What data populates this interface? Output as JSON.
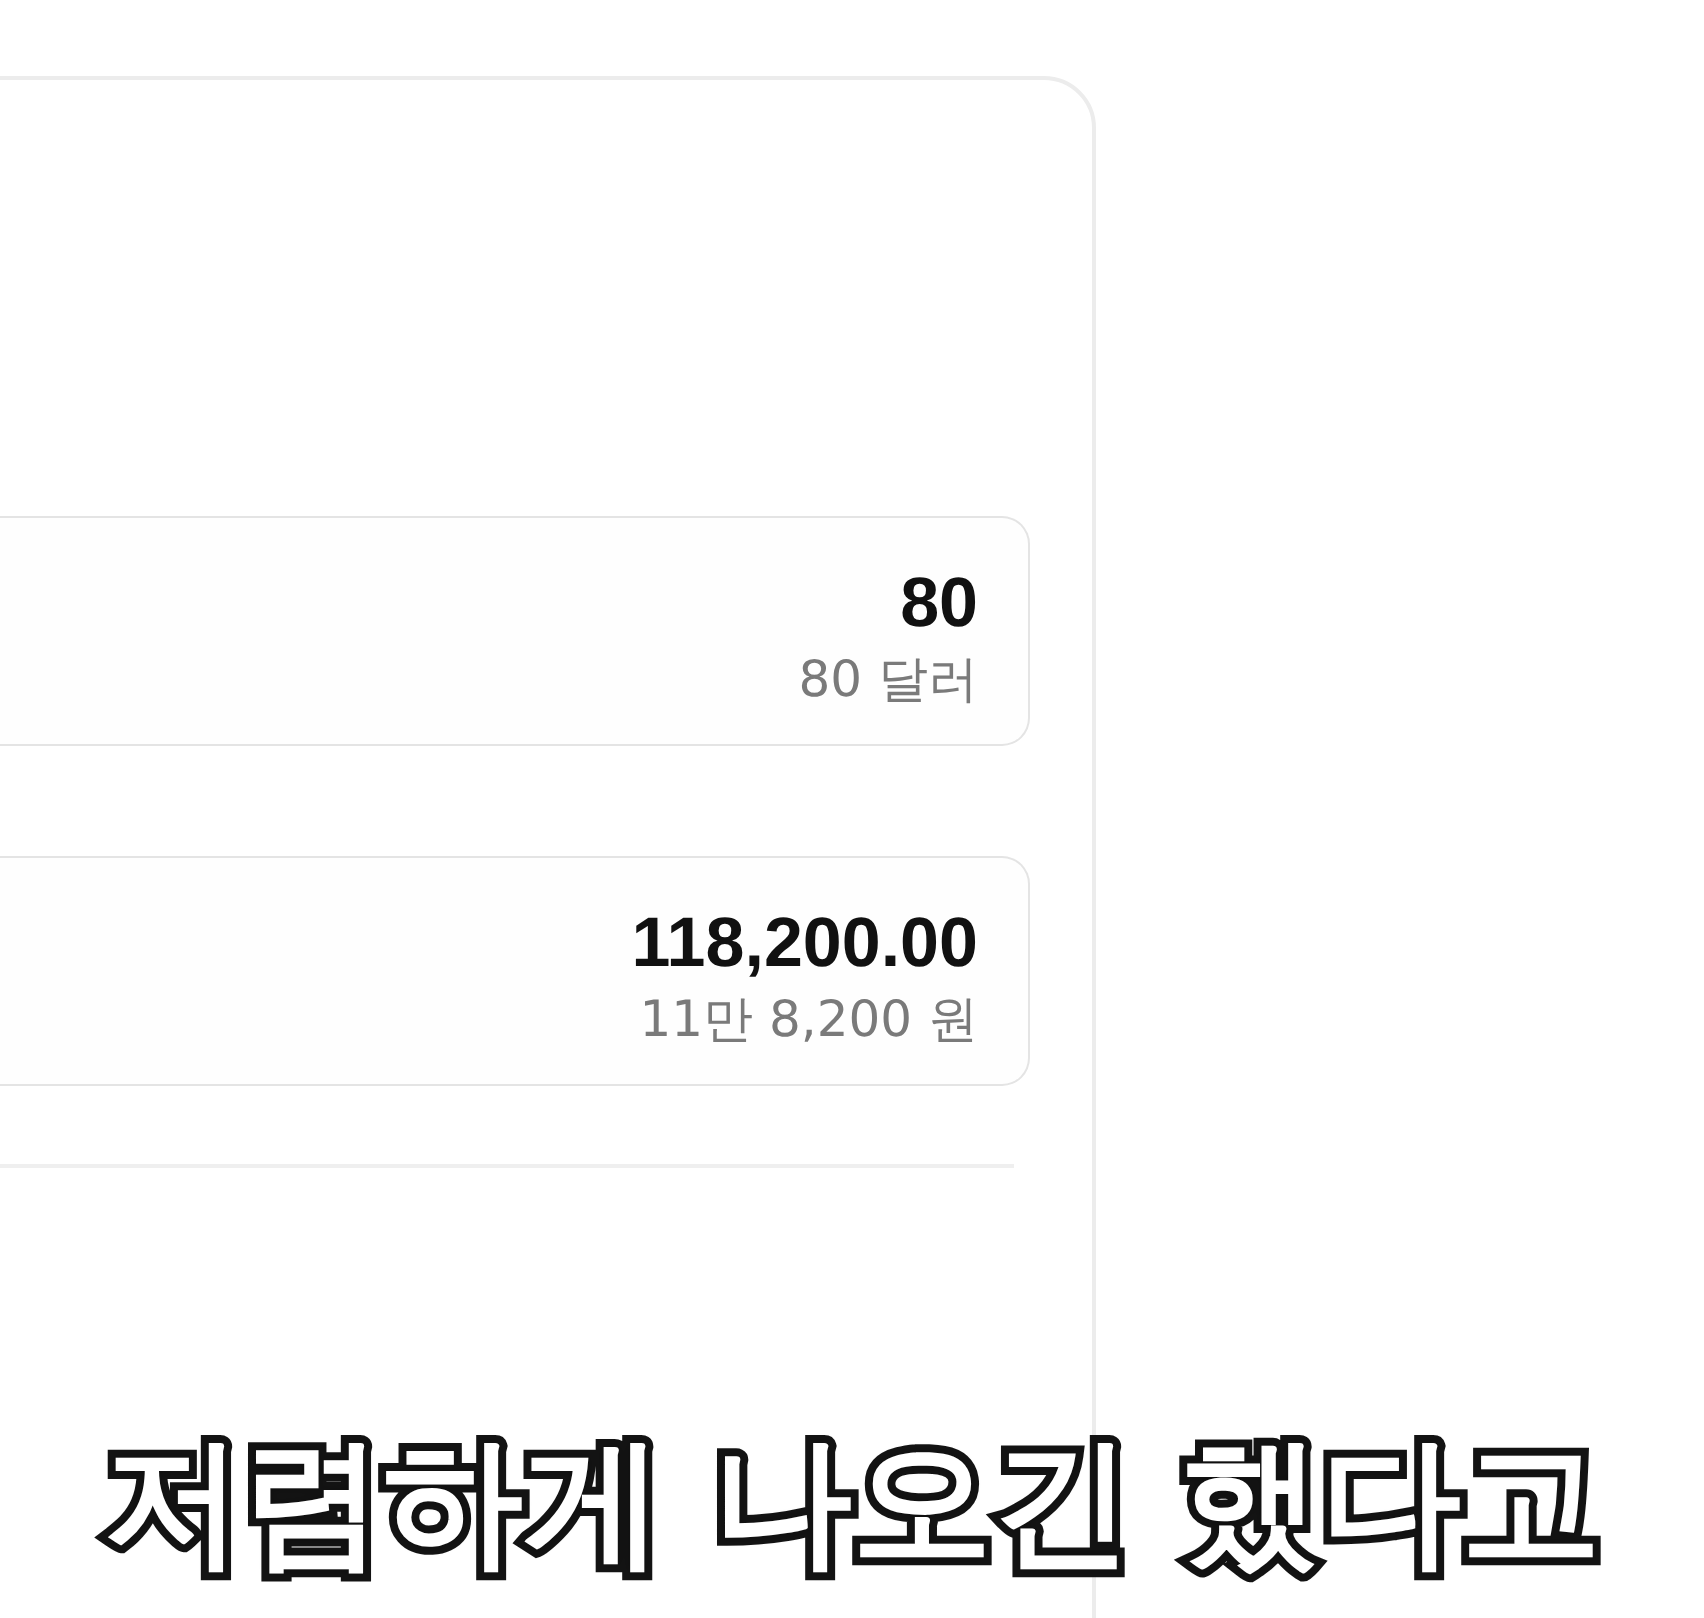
{
  "fields": [
    {
      "value": "80",
      "converted": "80 달러"
    },
    {
      "value": "118,200.00",
      "converted": "11만 8,200 원"
    }
  ],
  "caption": "저렴하게 나오긴 했다고"
}
